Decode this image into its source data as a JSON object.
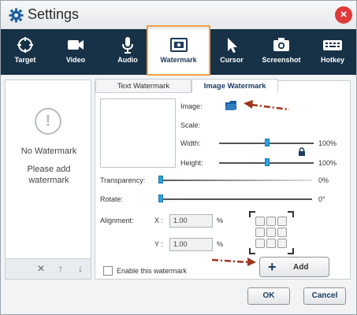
{
  "window": {
    "title": "Settings",
    "close_icon": "×"
  },
  "toolbar": {
    "items": [
      {
        "label": "Target",
        "icon": "target-icon"
      },
      {
        "label": "Video",
        "icon": "video-camera-icon"
      },
      {
        "label": "Audio",
        "icon": "microphone-icon"
      },
      {
        "label": "Watermark",
        "icon": "watermark-icon",
        "active": true
      },
      {
        "label": "Cursor",
        "icon": "cursor-icon"
      },
      {
        "label": "Screenshot",
        "icon": "camera-icon"
      },
      {
        "label": "Hotkey",
        "icon": "keyboard-icon"
      }
    ],
    "active_color": "#ffffff",
    "bg_color": "#173247",
    "highlight_color": "#f2a045"
  },
  "left_panel": {
    "empty_icon": "!",
    "empty_title": "No Watermark",
    "empty_hint": "Please add watermark",
    "actions": [
      {
        "name": "delete",
        "glyph": "✕"
      },
      {
        "name": "move-up",
        "glyph": "↑"
      },
      {
        "name": "move-down",
        "glyph": "↓"
      }
    ]
  },
  "tabs": {
    "text": "Text Watermark",
    "image": "Image Watermark",
    "active": "image"
  },
  "image_tab": {
    "image_label": "Image:",
    "scale_label": "Scale:",
    "width_label": "Width:",
    "width_value": "100%",
    "height_label": "Height:",
    "height_value": "100%",
    "transparency_label": "Transparency:",
    "transparency_value": "0%",
    "rotate_label": "Rotate:",
    "rotate_value": "0°",
    "alignment_label": "Alignment:",
    "x_label": "X :",
    "x_value": "1.00",
    "x_unit": "%",
    "y_label": "Y :",
    "y_value": "1.00",
    "y_unit": "%",
    "enable_label": "Enable this watermark",
    "add_label": "Add",
    "add_icon": "+"
  },
  "footer": {
    "ok_label": "OK",
    "cancel_label": "Cancel"
  },
  "colors": {
    "accent": "#1c3f66",
    "annotation_arrow": "#a0341e"
  }
}
